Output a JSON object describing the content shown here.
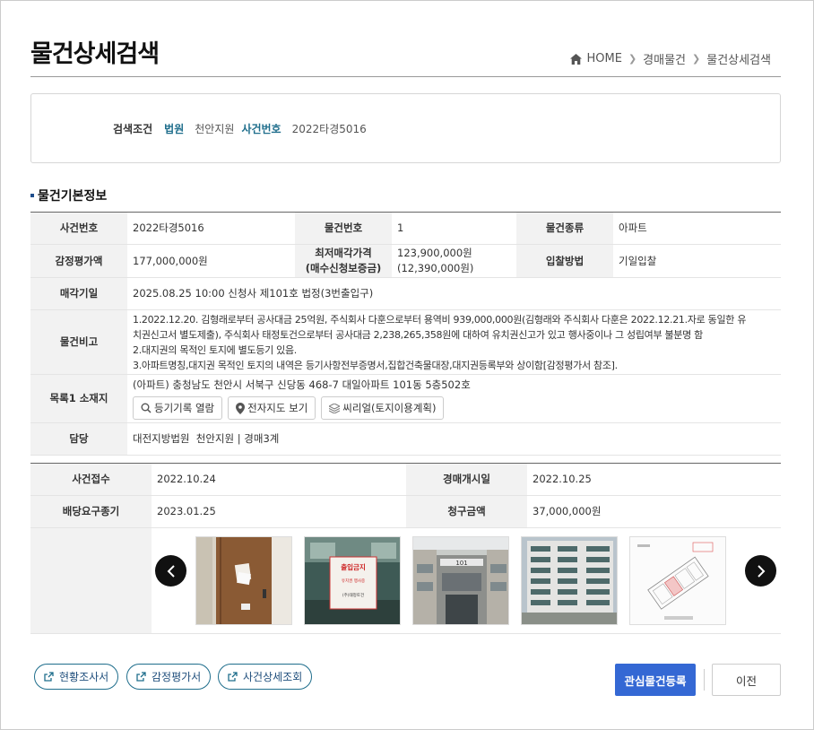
{
  "page": {
    "title": "물건상세검색",
    "breadcrumb": [
      "HOME",
      "경매물건",
      "물건상세검색"
    ]
  },
  "search": {
    "label": "검색조건",
    "court_key": "법원",
    "court_value": "천안지원",
    "case_key": "사건번호",
    "case_value": "2022타경5016"
  },
  "section": {
    "title": "물건기본정보"
  },
  "basic": {
    "case_no_label": "사건번호",
    "case_no": "2022타경5016",
    "item_no_label": "물건번호",
    "item_no": "1",
    "item_type_label": "물건종류",
    "item_type": "아파트",
    "appraisal_label": "감정평가액",
    "appraisal": "177,000,000원",
    "min_price_label_1": "최저매각가격",
    "min_price_label_2": "(매수신청보증금)",
    "min_price": "123,900,000원",
    "deposit": "(12,390,000원)",
    "bid_method_label": "입찰방법",
    "bid_method": "기일입찰",
    "sale_date_label": "매각기일",
    "sale_date": "2025.08.25 10:00 신청사 제101호 법정(3번출입구)",
    "remarks_label": "물건비고",
    "remarks": [
      "1.2022.12.20. 김형래로부터 공사대금 25억원, 주식회사 다훈으로부터 용역비 939,000,000원(김형래와 주식회사 다훈은 2022.12.21.자로 동일한 유",
      "치권신고서 별도제출), 주식회사 태정토건으로부터 공사대금 2,238,265,358원에 대하여 유치권신고가 있고 행사중이나 그 성립여부 불분명 함",
      "2.대지권의 목적인 토지에 별도등기 있음.",
      "3.아파트명칭,대지권 목적인 토지의 내역은 등기사항전부증명서,집합건축물대장,대지권등록부와 상이함[감정평가서 참조]."
    ],
    "location_label": "목록1 소재지",
    "location": "(아파트) 충청남도 천안시 서북구 신당동 468-7 대일아파트 101동 5층502호",
    "btn_registry": "등기기록 열람",
    "btn_map": "전자지도 보기",
    "btn_realty": "씨리얼(토지이용계획)",
    "dept_label": "담당",
    "dept": "대전지방법원  천안지원 | 경매3계"
  },
  "schedule": {
    "receipt_label": "사건접수",
    "receipt": "2022.10.24",
    "start_label": "경매개시일",
    "start": "2022.10.25",
    "deadline_label": "배당요구종기",
    "deadline": "2023.01.25",
    "claim_label": "청구금액",
    "claim": "37,000,000원"
  },
  "photos": {
    "prev_icon": "chevron-left-icon",
    "next_icon": "chevron-right-icon",
    "sign_line1": "출입금지",
    "sign_line2": "유치권 행사중",
    "sign_line3": "(주)태정토건",
    "building_no": "101"
  },
  "actions": {
    "status_report": "현황조사서",
    "appraisal_report": "감정평가서",
    "case_detail": "사건상세조회",
    "register_interest": "관심물건등록",
    "prev": "이전"
  },
  "colors": {
    "accent": "#1f6e8c",
    "primary": "#3468d4",
    "header_bg": "#f2f2f2"
  }
}
